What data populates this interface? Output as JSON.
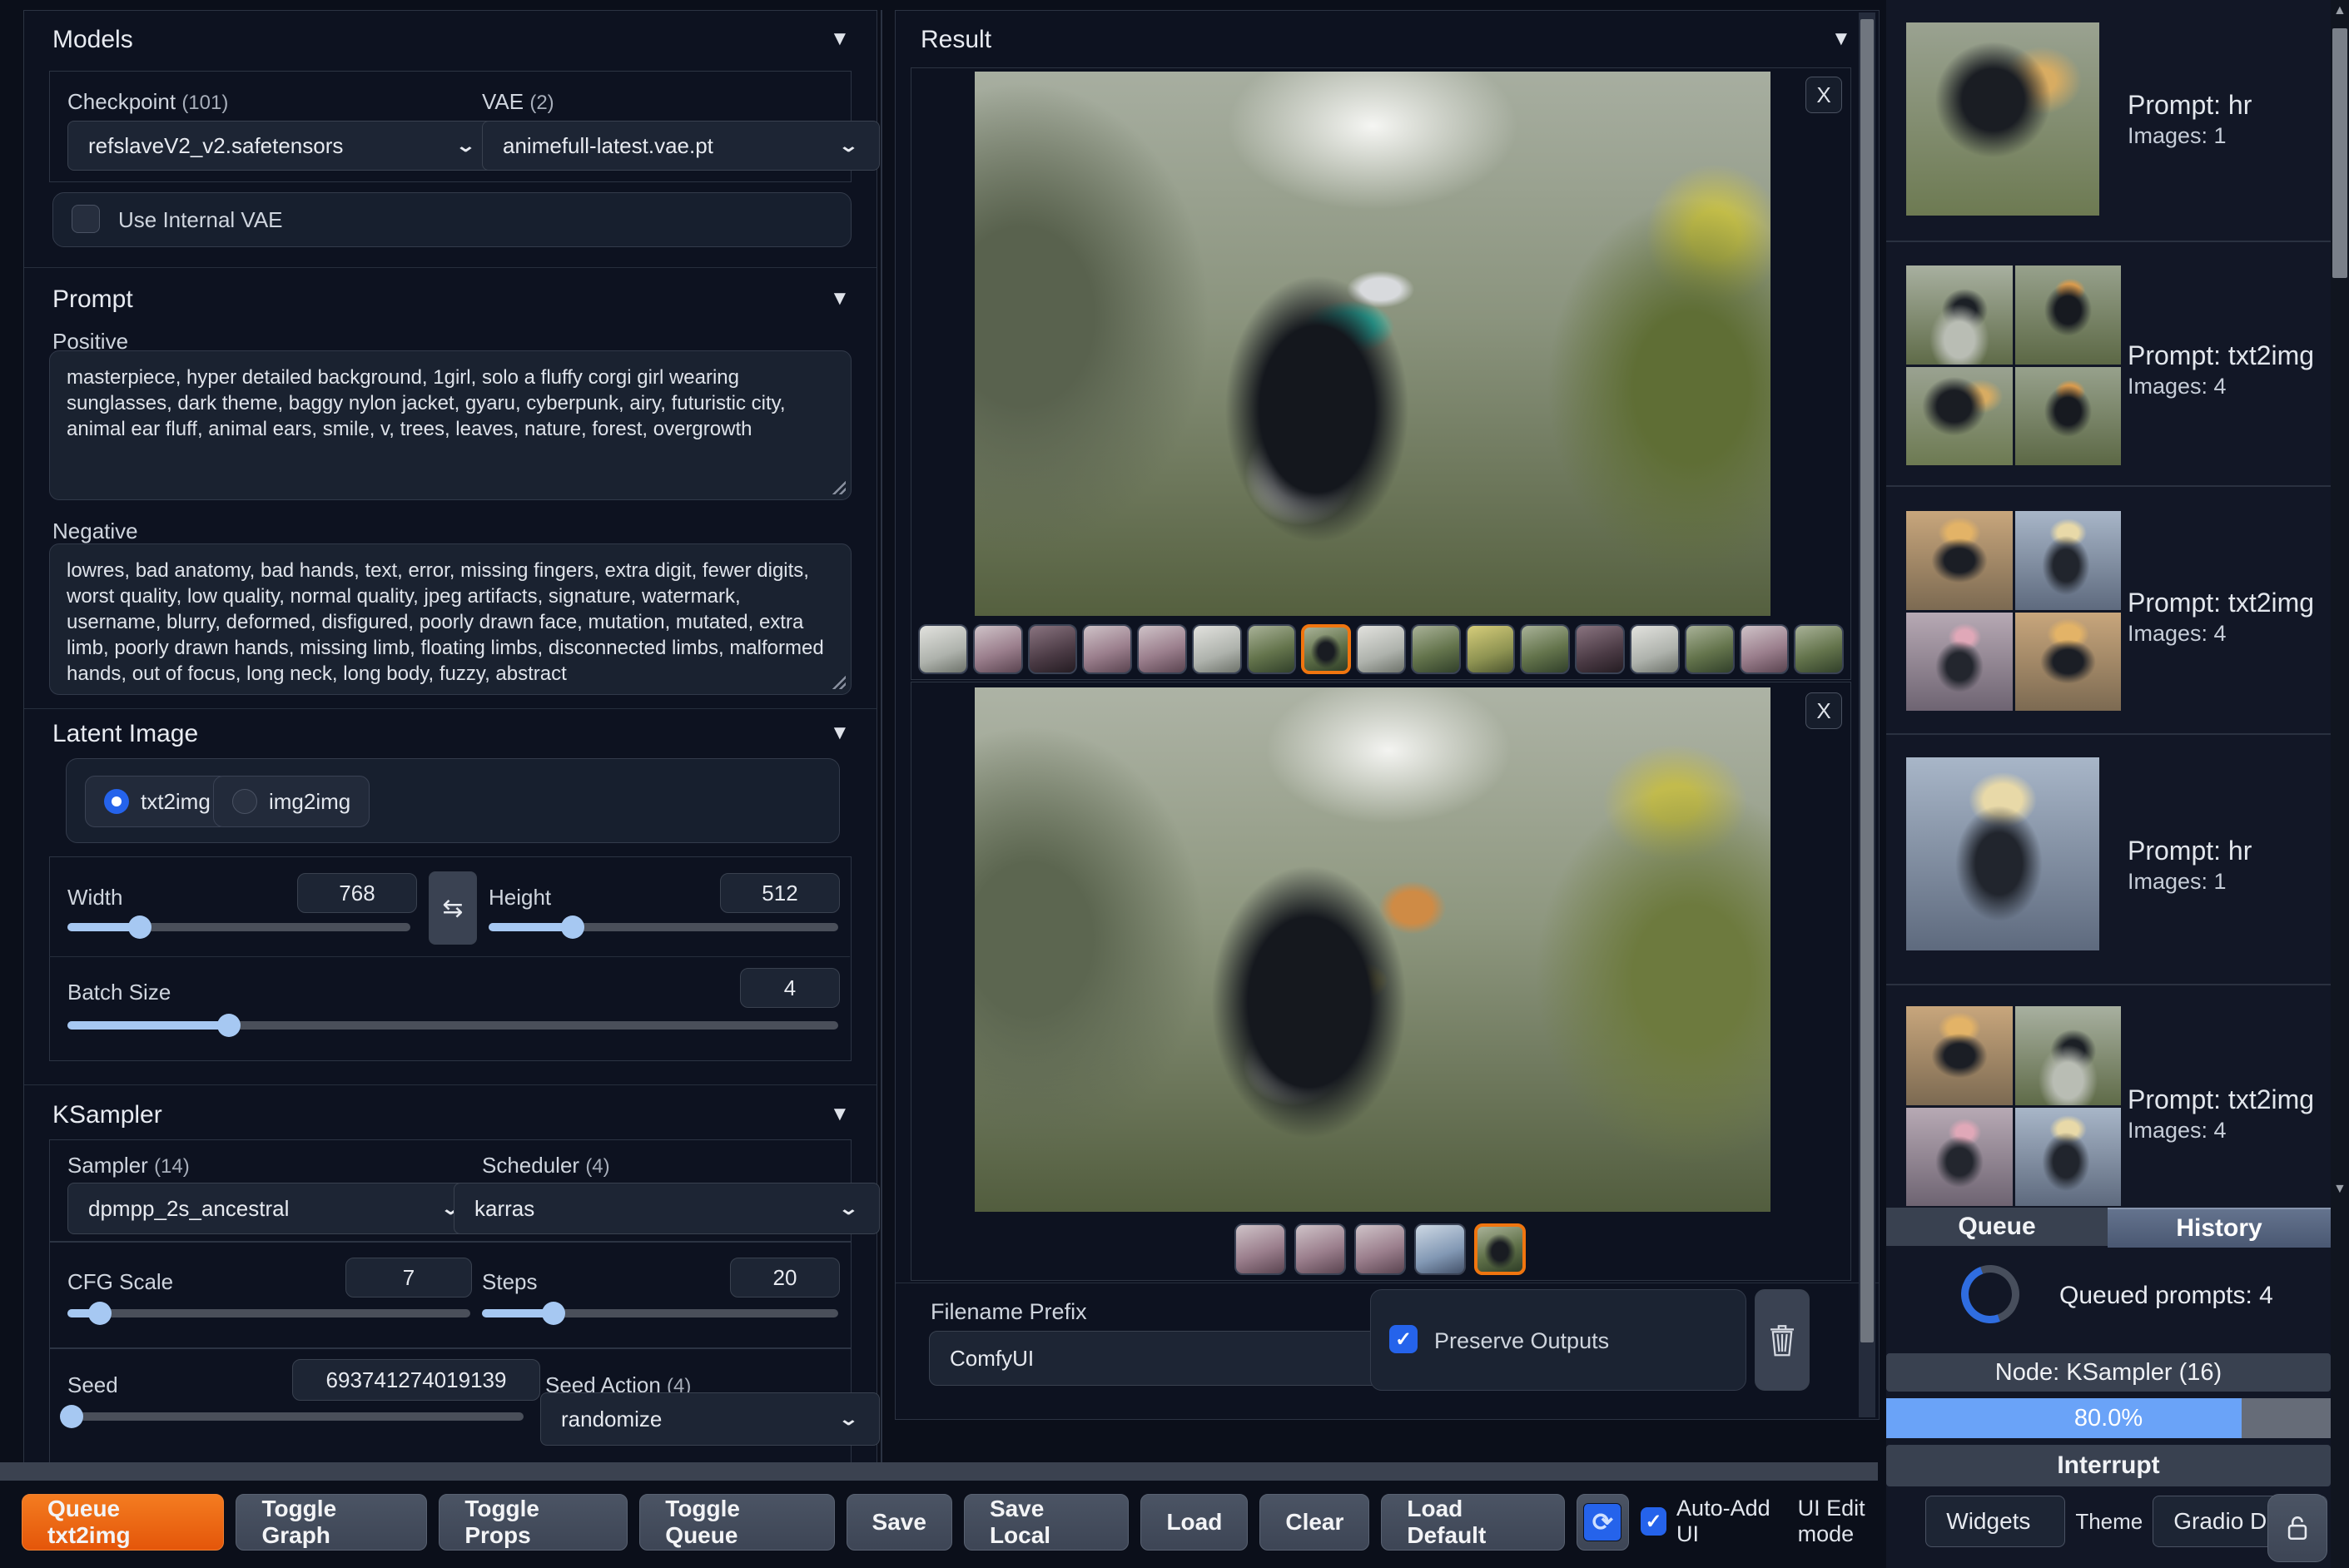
{
  "icons": {
    "collapse": "▼",
    "chevron": "⌄",
    "swap": "⇆",
    "close": "X",
    "check": "✓",
    "refresh": "⟳",
    "scroll_up": "▲",
    "scroll_down": "▼"
  },
  "colors": {
    "accent_orange": "#e8590c",
    "selection_orange": "#f0750f",
    "accent_blue": "#2563eb",
    "slider_blue": "#a6c8f2",
    "progress_blue": "#6aa3f8",
    "background": "#0b0f1a"
  },
  "models": {
    "header": "Models",
    "checkpoint_label": "Checkpoint",
    "checkpoint_count": "(101)",
    "checkpoint_value": "refslaveV2_v2.safetensors",
    "vae_label": "VAE",
    "vae_count": "(2)",
    "vae_value": "animefull-latest.vae.pt",
    "use_internal_vae_label": "Use Internal VAE",
    "use_internal_vae_checked": false
  },
  "prompt": {
    "header": "Prompt",
    "positive_label": "Positive",
    "positive_value": "masterpiece, hyper detailed background, 1girl, solo a fluffy corgi girl wearing sunglasses, dark theme, baggy nylon jacket, gyaru, cyberpunk, airy, futuristic city, animal ear fluff, animal ears, smile, v, trees, leaves, nature, forest, overgrowth",
    "negative_label": "Negative",
    "negative_value": "lowres, bad anatomy, bad hands, text, error, missing fingers, extra digit, fewer digits, worst quality, low quality, normal quality, jpeg artifacts, signature, watermark, username, blurry, deformed, disfigured, poorly drawn face, mutation, mutated, extra limb, poorly drawn hands, missing limb, floating limbs, disconnected limbs, malformed hands, out of focus, long neck, long body, fuzzy, abstract"
  },
  "latent": {
    "header": "Latent Image",
    "mode_txt2img": "txt2img",
    "mode_img2img": "img2img",
    "mode_selected": "txt2img",
    "width_label": "Width",
    "width_value": "768",
    "height_label": "Height",
    "height_value": "512",
    "batch_label": "Batch Size",
    "batch_value": "4"
  },
  "ksampler": {
    "header": "KSampler",
    "sampler_label": "Sampler",
    "sampler_count": "(14)",
    "sampler_value": "dpmpp_2s_ancestral",
    "scheduler_label": "Scheduler",
    "scheduler_count": "(4)",
    "scheduler_value": "karras",
    "cfg_label": "CFG Scale",
    "cfg_value": "7",
    "steps_label": "Steps",
    "steps_value": "20",
    "seed_label": "Seed",
    "seed_value": "693741274019139",
    "seed_action_label": "Seed Action",
    "seed_action_count": "(4)",
    "seed_action_value": "randomize"
  },
  "result": {
    "header": "Result",
    "gallery1_count": 17,
    "gallery1_selected_index": 8,
    "gallery2_count": 5,
    "gallery2_selected_index": 5,
    "filename_prefix_label": "Filename Prefix",
    "filename_prefix_value": "ComfyUI",
    "preserve_outputs_label": "Preserve Outputs",
    "preserve_outputs_checked": true
  },
  "sidebar": {
    "entries": [
      {
        "prompt": "Prompt: hr",
        "images": "Images: 1"
      },
      {
        "prompt": "Prompt: txt2img",
        "images": "Images: 4"
      },
      {
        "prompt": "Prompt: txt2img",
        "images": "Images: 4"
      },
      {
        "prompt": "Prompt: hr",
        "images": "Images: 1"
      },
      {
        "prompt": "Prompt: txt2img",
        "images": "Images: 4"
      }
    ],
    "tabs": {
      "queue": "Queue",
      "history": "History"
    },
    "queue_panel": {
      "queued_text": "Queued prompts: 4",
      "node_text": "Node: KSampler (16)",
      "progress_text": "80.0%",
      "progress_percent": 80,
      "interrupt_label": "Interrupt"
    }
  },
  "toolbar": {
    "queue_button": "Queue txt2img",
    "toggle_graph": "Toggle Graph",
    "toggle_props": "Toggle Props",
    "toggle_queue": "Toggle Queue",
    "save": "Save",
    "save_local": "Save Local",
    "load": "Load",
    "clear": "Clear",
    "load_default": "Load Default",
    "auto_add_ui": "Auto-Add UI",
    "auto_add_ui_checked": true,
    "ui_edit_mode": "UI Edit mode",
    "widgets_value": "Widgets",
    "theme_label": "Theme",
    "theme_value": "Gradio Dark"
  }
}
